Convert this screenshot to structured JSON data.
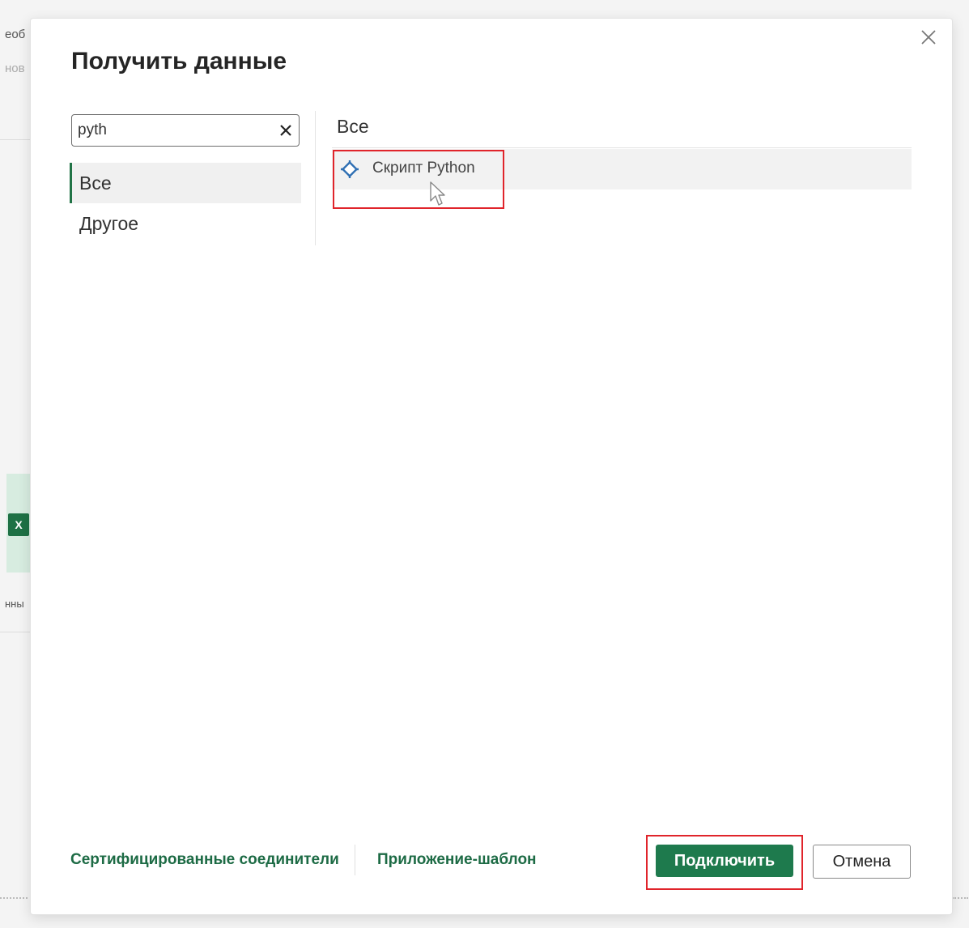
{
  "background": {
    "top_text": "еоб",
    "second_text": "нов",
    "side_label": "нны",
    "excel_icon_letter": "X"
  },
  "dialog": {
    "title": "Получить данные",
    "close_label": "×",
    "search": {
      "value": "pyth",
      "clear_label": "✕"
    },
    "categories": [
      {
        "label": "Все",
        "selected": true
      },
      {
        "label": "Другое",
        "selected": false
      }
    ],
    "results_header": "Все",
    "results": [
      {
        "label": "Скрипт Python",
        "icon": "python-script-icon"
      }
    ],
    "footer": {
      "certified_link": "Сертифицированные соединители",
      "template_link": "Приложение-шаблон",
      "connect_label": "Подключить",
      "cancel_label": "Отмена"
    }
  },
  "colors": {
    "accent": "#1e7a4d",
    "highlight": "#e0242b",
    "python_icon": "#2f6fb3"
  }
}
